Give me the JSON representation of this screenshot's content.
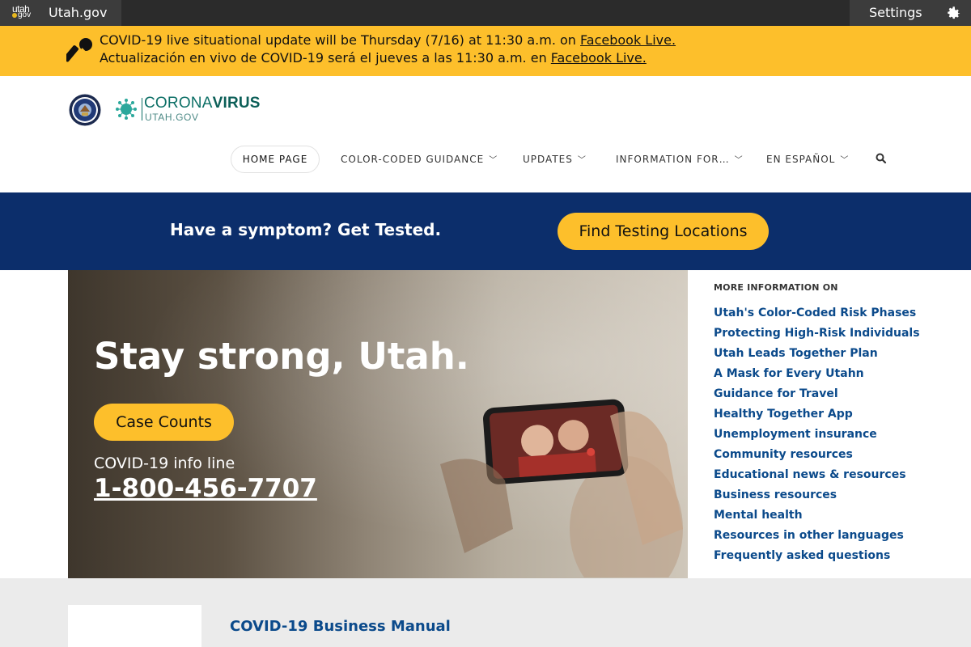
{
  "topbar": {
    "logo_top": "utah",
    "logo_bottom": "gov",
    "site_name": "Utah.gov",
    "settings_label": "Settings"
  },
  "alert": {
    "line1_text": "COVID-19 live situational update will be Thursday (7/16) at 11:30 a.m. on ",
    "line1_link": "Facebook Live.",
    "line2_text": "Actualización en vivo de COVID-19 será el jueves a las 11:30 a.m. en ",
    "line2_link": "Facebook Live."
  },
  "header": {
    "logo_word_light": "CORONA",
    "logo_word_bold": "VIRUS",
    "logo_sub": "UTAH.GOV"
  },
  "nav": {
    "items": [
      {
        "label": "HOME PAGE"
      },
      {
        "label": "COLOR-CODED GUIDANCE"
      },
      {
        "label": "UPDATES"
      },
      {
        "label": "INFORMATION FOR…"
      },
      {
        "label": "EN ESPAÑOL"
      }
    ]
  },
  "band": {
    "headline": "Have a symptom? Get Tested.",
    "button": "Find Testing Locations"
  },
  "hero": {
    "title": "Stay strong, Utah.",
    "case_button": "Case Counts",
    "info_label": "COVID-19 info line",
    "phone": "1-800-456-7707"
  },
  "sidebar": {
    "title": "MORE INFORMATION ON",
    "items": [
      "Utah's Color-Coded Risk Phases",
      "Protecting High-Risk Individuals",
      "Utah Leads Together Plan",
      "A Mask for Every Utahn",
      "Guidance for Travel",
      "Healthy Together App",
      "Unemployment insurance",
      "Community resources",
      "Educational news & resources",
      "Business resources",
      "Mental health",
      "Resources in other languages",
      "Frequently asked questions"
    ]
  },
  "bottom": {
    "manual_title": "COVID-19 Business Manual"
  },
  "colors": {
    "alert_yellow": "#fdbf2b",
    "band_navy": "#0c2e6b",
    "link_blue": "#0b4a8b",
    "logo_teal": "#0c6f66"
  }
}
